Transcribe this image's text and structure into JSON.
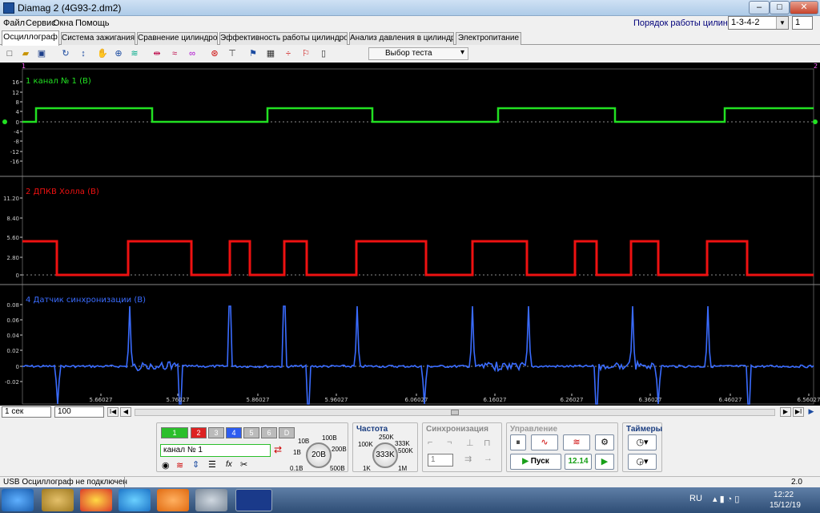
{
  "window": {
    "title": "Diamag 2 (4G93-2.dm2)",
    "min_label": "–",
    "max_label": "□",
    "close_label": "✕"
  },
  "menu": [
    "Файл",
    "Сервис",
    "Окна",
    "Помощь"
  ],
  "cyl_order": {
    "label": "Порядок работы цилиндров",
    "value": "1-3-4-2",
    "spin": "1"
  },
  "tabs": [
    "Осциллограф",
    "Система зажигания",
    "Сравнение цилиндров",
    "Эффективность работы цилиндров",
    "Анализ давления в цилиндре",
    "Электропитание"
  ],
  "test_select": "Выбор теста",
  "channels": [
    {
      "name": "1 канал № 1 (В)",
      "color": "#22e022",
      "yticks": [
        "16",
        "12",
        "8",
        "4",
        "0",
        "-4",
        "-8",
        "-12",
        "-16"
      ]
    },
    {
      "name": "2 ДПКВ Холла (В)",
      "color": "#ee1111",
      "yticks": [
        "11.20",
        "8.40",
        "5.60",
        "2.80",
        "0"
      ]
    },
    {
      "name": "4 Датчик синхронизации (В)",
      "color": "#3a6cff",
      "yticks": [
        "0.08",
        "0.06",
        "0.04",
        "0.02",
        "0",
        "-0.02"
      ]
    }
  ],
  "xticks": [
    "5.66027",
    "5.76027",
    "5.86027",
    "5.96027",
    "6.06027",
    "6.16027",
    "6.26027",
    "6.36027",
    "6.46027",
    "6.56027"
  ],
  "markers": {
    "top_left": "1",
    "top_right": "2"
  },
  "timebase": {
    "value": "1 сек",
    "scale": "100"
  },
  "channel_buttons": [
    "1",
    "2",
    "3",
    "4",
    "5",
    "6",
    "D"
  ],
  "channel_name": "канал № 1",
  "amplitude": {
    "center": "20В",
    "labels": [
      "10В",
      "100В",
      "1В",
      "200В",
      "0.1В",
      "500В"
    ]
  },
  "frequency": {
    "title": "Частота",
    "center": "333K",
    "labels": [
      "250K",
      "100K",
      "333K",
      "500K",
      "1K",
      "1M"
    ]
  },
  "sync": {
    "title": "Синхронизация",
    "channel": "1"
  },
  "control": {
    "title": "Управление",
    "start": "Пуск",
    "voltage": "12.14"
  },
  "timers": {
    "title": "Таймеры"
  },
  "status": {
    "left": "USB Осциллограф не подключен",
    "right": "2.0"
  },
  "tray": {
    "lang": "RU",
    "time": "12:22",
    "date": "15/12/19"
  }
}
